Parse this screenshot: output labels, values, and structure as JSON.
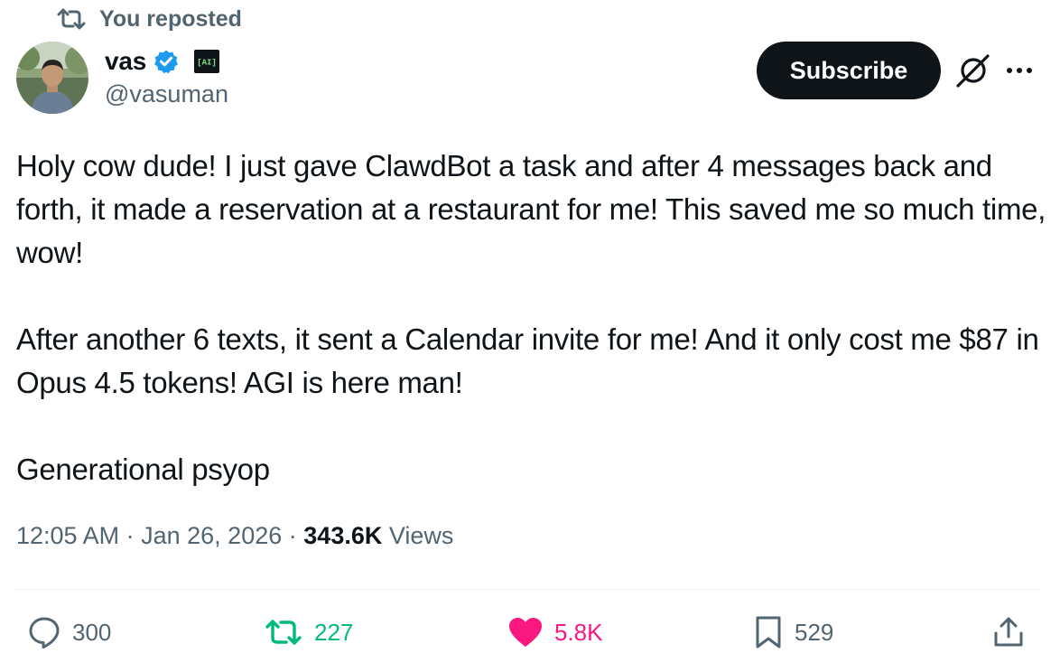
{
  "repost_banner": {
    "icon": "repost-icon",
    "text": "You reposted"
  },
  "author": {
    "display_name": "vas",
    "verified_icon": "verified-badge-icon",
    "affiliate_badge_text": "[AI]",
    "handle": "@vasuman"
  },
  "header_actions": {
    "subscribe_label": "Subscribe",
    "grok_icon": "grok-icon",
    "more_icon": "more-options-icon"
  },
  "tweet": {
    "paragraphs": [
      "Holy cow dude! I just gave ClawdBot a task and after 4 messages back and forth, it made a reservation at a restaurant for me! This saved me so much time, wow!",
      "After another 6 texts, it sent a Calendar invite for me! And it only cost me $87 in Opus 4.5 tokens! AGI is here man!",
      "Generational psyop"
    ]
  },
  "meta": {
    "time": "12:05 AM",
    "separator": "·",
    "date": "Jan 26, 2026",
    "views_count": "343.6K",
    "views_label": "Views"
  },
  "actions": {
    "reply": {
      "icon": "reply-icon",
      "count": "300"
    },
    "repost": {
      "icon": "repost-icon",
      "count": "227",
      "active": true,
      "color": "#00ba7c"
    },
    "like": {
      "icon": "heart-icon",
      "count": "5.8K",
      "active": true,
      "color": "#f91880"
    },
    "bookmark": {
      "icon": "bookmark-icon",
      "count": "529"
    },
    "share": {
      "icon": "share-icon"
    }
  },
  "colors": {
    "text_primary": "#0f1419",
    "text_secondary": "#536471",
    "verified_blue": "#1d9bf0",
    "button_dark": "#0f1419"
  }
}
